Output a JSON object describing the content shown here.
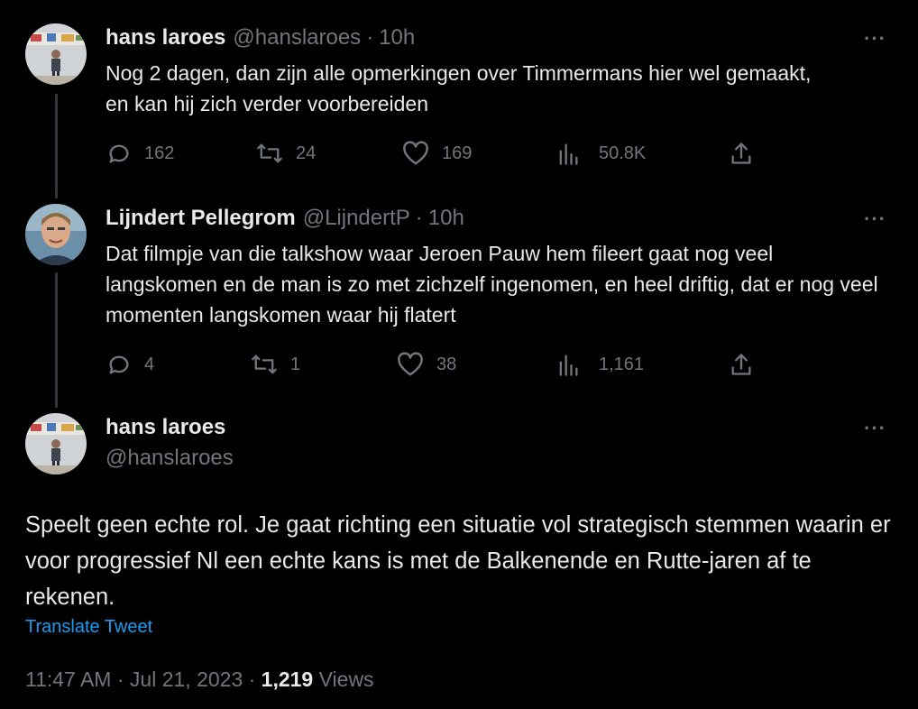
{
  "tweets": [
    {
      "display_name": "hans laroes",
      "handle": "@hanslaroes",
      "separator": "·",
      "time": "10h",
      "text": "Nog 2 dagen, dan zijn alle opmerkingen over Timmermans hier wel gemaakt, en kan hij zich verder voorbereiden",
      "replies": "162",
      "retweets": "24",
      "likes": "169",
      "views": "50.8K"
    },
    {
      "display_name": "Lijndert Pellegrom",
      "handle": "@LijndertP",
      "separator": "·",
      "time": "10h",
      "text": "Dat filmpje van die talkshow waar Jeroen Pauw hem fileert gaat nog veel langskomen en de man is zo met zichzelf ingenomen, en heel driftig, dat er nog veel momenten langskomen waar hij flatert",
      "replies": "4",
      "retweets": "1",
      "likes": "38",
      "views": "1,161"
    }
  ],
  "main_tweet": {
    "display_name": "hans laroes",
    "handle": "@hanslaroes",
    "text": "Speelt geen echte rol. Je gaat richting een situatie vol strategisch stemmen waarin er voor progressief Nl een echte kans is met de Balkenende en Rutte-jaren af te rekenen.",
    "translate_label": "Translate Tweet",
    "timestamp": "11:47 AM · Jul 21, 2023 ·",
    "view_count": "1,219",
    "views_label": "Views"
  },
  "more_label": "···",
  "icons": [
    "reply-icon",
    "retweet-icon",
    "like-icon",
    "views-icon",
    "share-icon",
    "more-icon"
  ]
}
